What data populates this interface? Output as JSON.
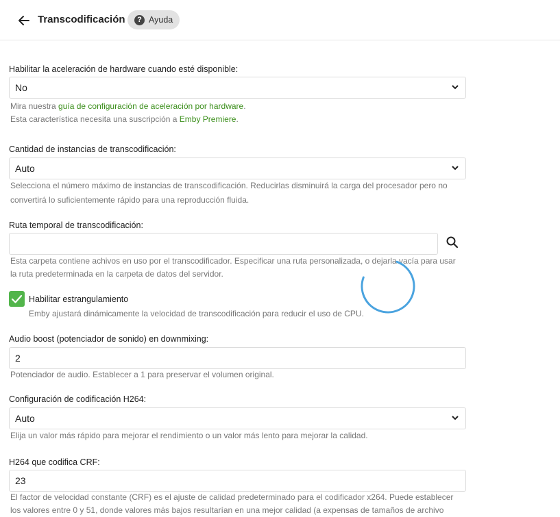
{
  "header": {
    "title": "Transcodificación",
    "help_label": "Ayuda"
  },
  "hw_accel": {
    "label": "Habilitar la aceleración de hardware cuando esté disponible:",
    "value": "No",
    "desc1_prefix": "Mira nuestra ",
    "desc1_link": "guía de configuración de aceleración por hardware",
    "desc1_suffix": ".",
    "desc2_prefix": "Esta característica necesita una suscripción a ",
    "desc2_link": "Emby Premiere",
    "desc2_suffix": "."
  },
  "instances": {
    "label": "Cantidad de instancias de transcodificación:",
    "value": "Auto",
    "desc1": "Selecciona el número máximo de instancias de transcodificación. Reducirlas disminuirá la carga del procesador pero no",
    "desc2": "convertirá lo suficientemente rápido para una reproducción fluida."
  },
  "temp_path": {
    "label": "Ruta temporal de transcodificación:",
    "value": "",
    "desc1": "Esta carpeta contiene achivos en uso por el transcodificador. Especificar una ruta personalizada, o dejarla vacía para usar",
    "desc2": "la ruta predeterminada en la carpeta de datos del servidor."
  },
  "throttle": {
    "label": "Habilitar estrangulamiento",
    "checked": true,
    "desc": "Emby ajustará dinámicamente la velocidad de transcodificación para reducir el uso de CPU."
  },
  "audio_boost": {
    "label": "Audio boost (potenciador de sonido) en downmixing:",
    "value": "2",
    "desc": "Potenciador de audio. Establecer a 1 para preservar el volumen original."
  },
  "h264_preset": {
    "label": "Configuración de codificación H264:",
    "value": "Auto",
    "desc": "Elija un valor más rápido para mejorar el rendimiento o un valor más lento para mejorar la calidad."
  },
  "h264_crf": {
    "label": "H264 que codifica CRF:",
    "value": "23",
    "desc1": "El factor de velocidad constante (CRF) es el ajuste de calidad predeterminado para el codificador x264. Puede establecer",
    "desc2": "los valores entre 0 y 51, donde valores más bajos resultarían en una mejor calidad (a expensas de tamaños de archivo"
  },
  "colors": {
    "accent": "#52b54b",
    "link": "#3a8e1a",
    "spinner": "#4aa3df"
  }
}
